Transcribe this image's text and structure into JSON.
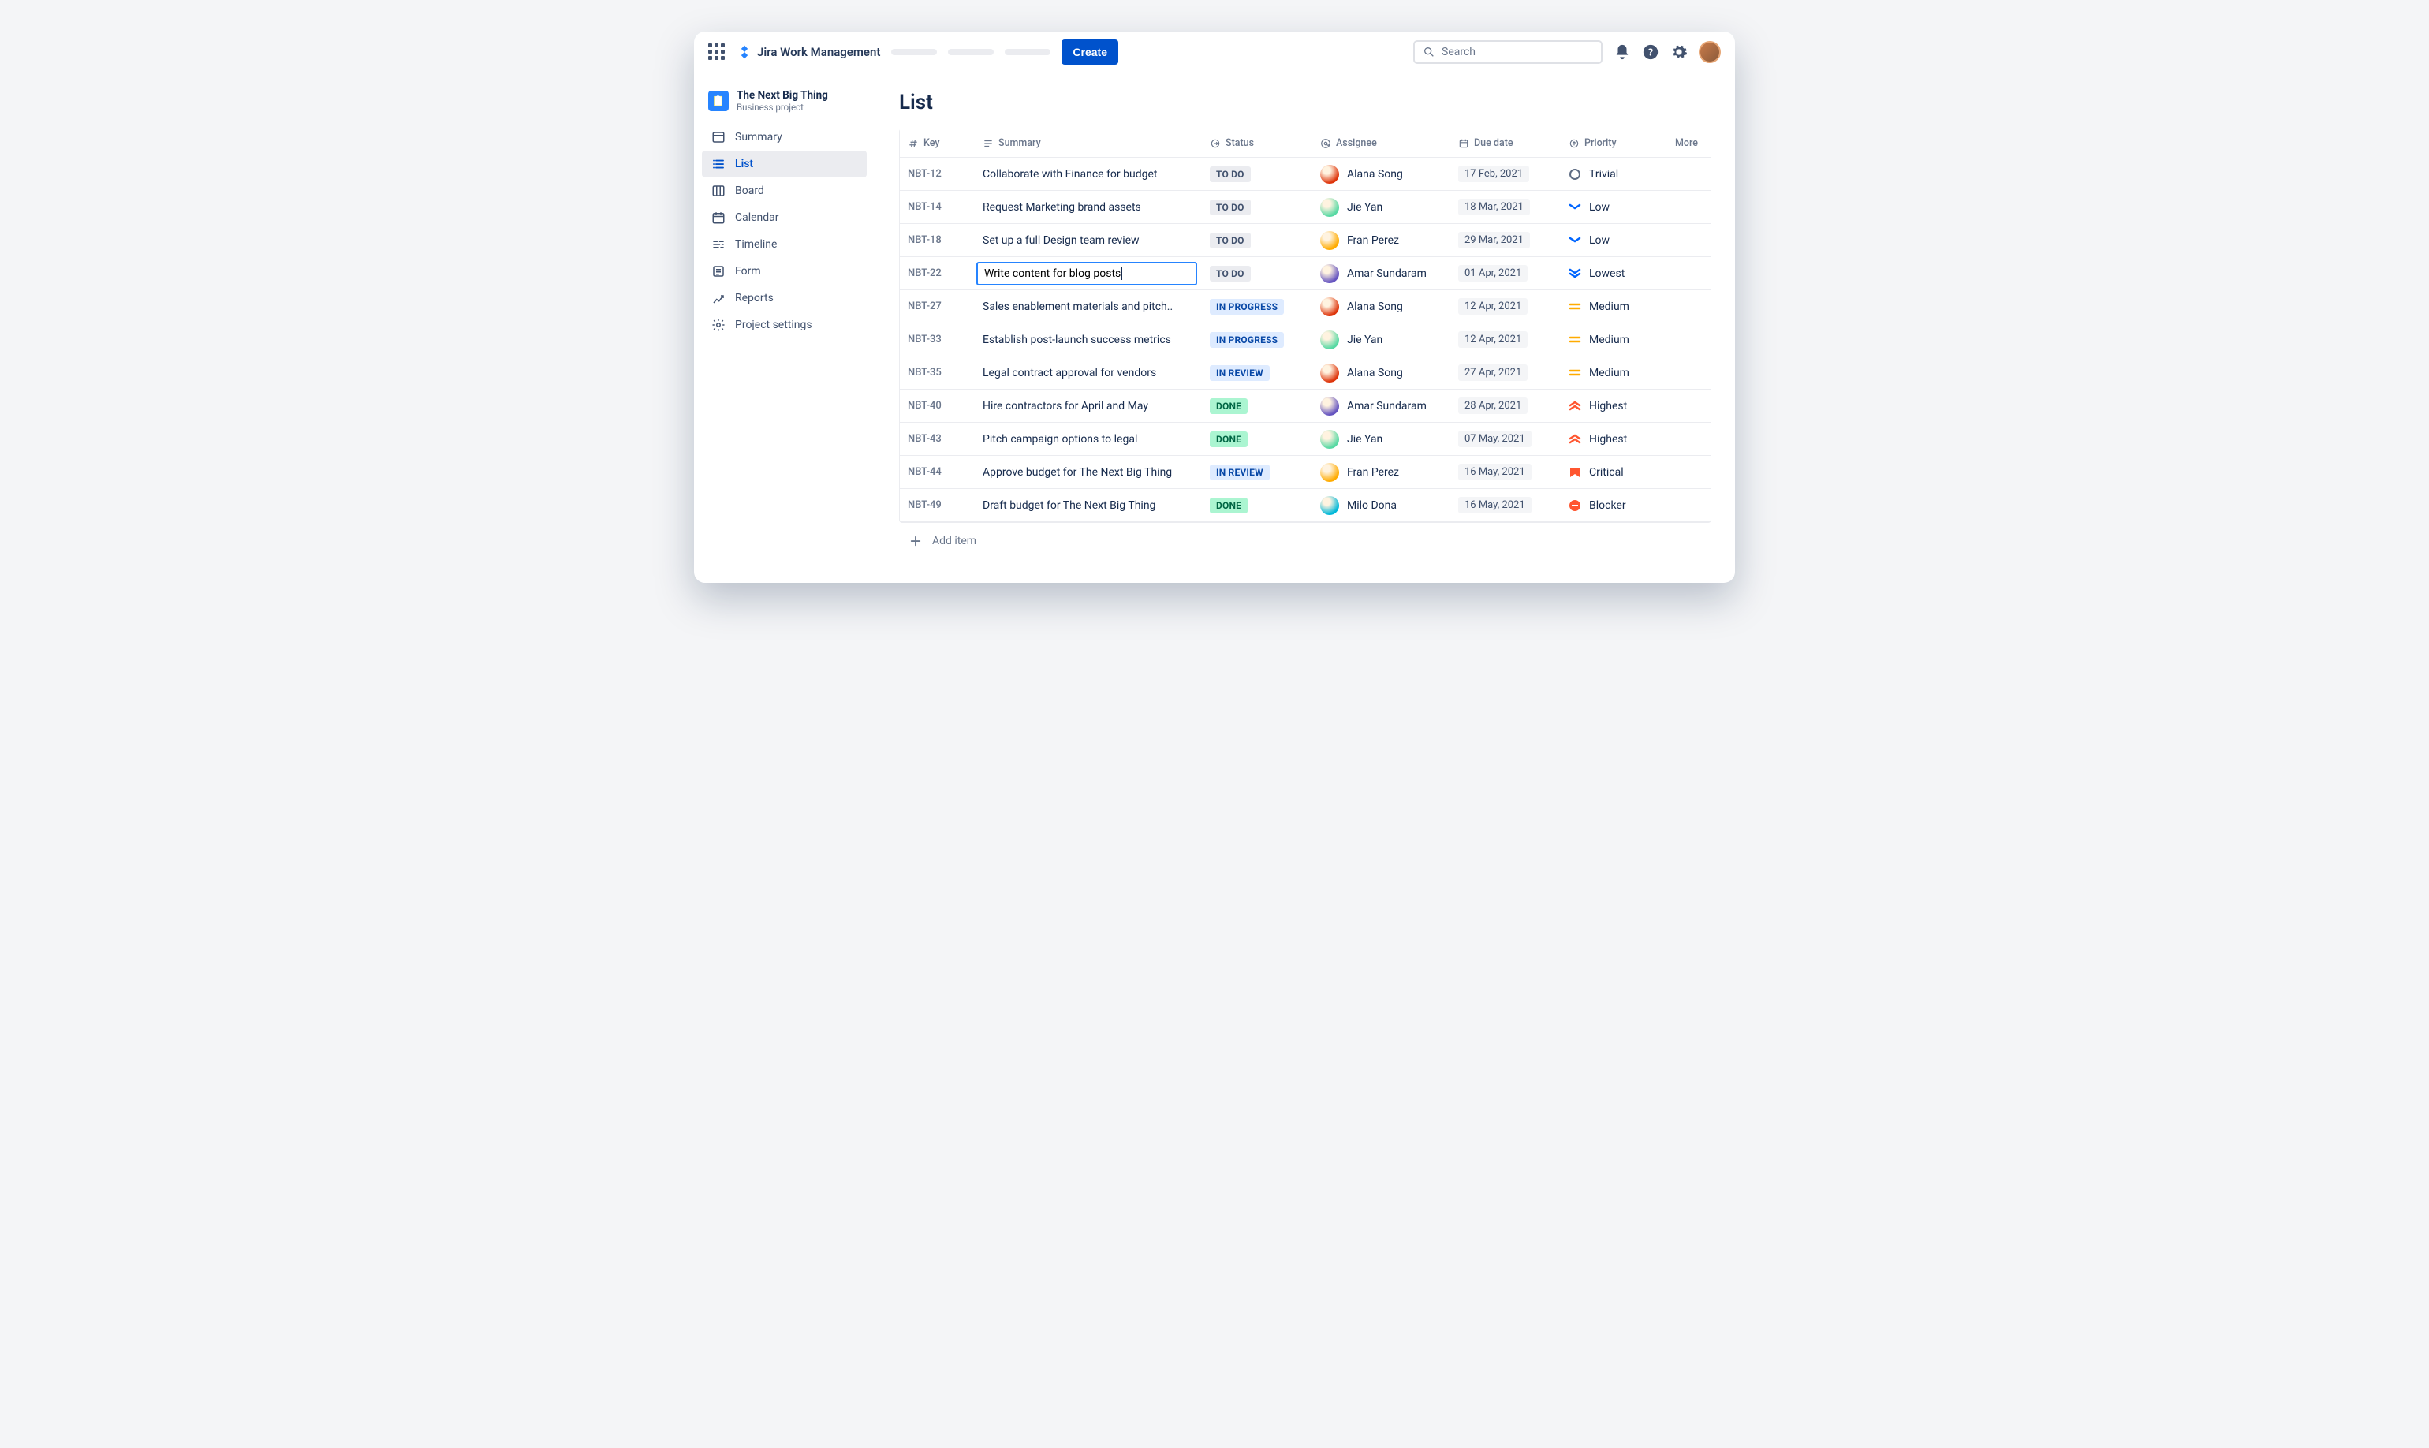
{
  "header": {
    "product_name": "Jira Work Management",
    "create_label": "Create",
    "search_placeholder": "Search"
  },
  "project": {
    "name": "The Next Big Thing",
    "type": "Business project"
  },
  "sidebar": {
    "items": [
      {
        "label": "Summary",
        "icon": "summary"
      },
      {
        "label": "List",
        "icon": "list",
        "active": true
      },
      {
        "label": "Board",
        "icon": "board"
      },
      {
        "label": "Calendar",
        "icon": "calendar"
      },
      {
        "label": "Timeline",
        "icon": "timeline"
      },
      {
        "label": "Form",
        "icon": "form"
      },
      {
        "label": "Reports",
        "icon": "reports"
      },
      {
        "label": "Project settings",
        "icon": "settings"
      }
    ]
  },
  "page": {
    "title": "List",
    "add_item_label": "Add item"
  },
  "columns": {
    "key": "Key",
    "summary": "Summary",
    "status": "Status",
    "assignee": "Assignee",
    "due": "Due date",
    "priority": "Priority",
    "more": "More"
  },
  "rows": [
    {
      "key": "NBT-12",
      "summary": "Collaborate with Finance for budget",
      "status": "TO DO",
      "status_kind": "todo",
      "assignee": "Alana Song",
      "av": "#de350b",
      "due": "17 Feb, 2021",
      "priority": "Trivial",
      "prio_kind": "trivial"
    },
    {
      "key": "NBT-14",
      "summary": "Request Marketing brand assets",
      "status": "TO DO",
      "status_kind": "todo",
      "assignee": "Jie Yan",
      "av": "#57d9a3",
      "due": "18 Mar, 2021",
      "priority": "Low",
      "prio_kind": "low"
    },
    {
      "key": "NBT-18",
      "summary": "Set up a full Design team review",
      "status": "TO DO",
      "status_kind": "todo",
      "assignee": "Fran Perez",
      "av": "#ffab00",
      "due": "29 Mar, 2021",
      "priority": "Low",
      "prio_kind": "low"
    },
    {
      "key": "NBT-22",
      "summary": "Write content for blog posts",
      "status": "TO DO",
      "status_kind": "todo",
      "assignee": "Amar Sundaram",
      "av": "#6554c0",
      "due": "01 Apr, 2021",
      "priority": "Lowest",
      "prio_kind": "lowest",
      "editing": true
    },
    {
      "key": "NBT-27",
      "summary": "Sales enablement materials and pitch..",
      "status": "IN PROGRESS",
      "status_kind": "prog",
      "assignee": "Alana Song",
      "av": "#de350b",
      "due": "12 Apr, 2021",
      "priority": "Medium",
      "prio_kind": "medium"
    },
    {
      "key": "NBT-33",
      "summary": "Establish post-launch success metrics",
      "status": "IN PROGRESS",
      "status_kind": "prog",
      "assignee": "Jie Yan",
      "av": "#57d9a3",
      "due": "12 Apr, 2021",
      "priority": "Medium",
      "prio_kind": "medium"
    },
    {
      "key": "NBT-35",
      "summary": "Legal contract approval for vendors",
      "status": "IN REVIEW",
      "status_kind": "review",
      "assignee": "Alana Song",
      "av": "#de350b",
      "due": "27 Apr, 2021",
      "priority": "Medium",
      "prio_kind": "medium"
    },
    {
      "key": "NBT-40",
      "summary": "Hire contractors for April and May",
      "status": "DONE",
      "status_kind": "done",
      "assignee": "Amar Sundaram",
      "av": "#6554c0",
      "due": "28 Apr, 2021",
      "priority": "Highest",
      "prio_kind": "highest"
    },
    {
      "key": "NBT-43",
      "summary": "Pitch campaign options to legal",
      "status": "DONE",
      "status_kind": "done",
      "assignee": "Jie Yan",
      "av": "#57d9a3",
      "due": "07 May, 2021",
      "priority": "Highest",
      "prio_kind": "highest"
    },
    {
      "key": "NBT-44",
      "summary": "Approve budget for The Next Big Thing",
      "status": "IN REVIEW",
      "status_kind": "review",
      "assignee": "Fran Perez",
      "av": "#ffab00",
      "due": "16 May, 2021",
      "priority": "Critical",
      "prio_kind": "critical"
    },
    {
      "key": "NBT-49",
      "summary": "Draft budget for The Next Big Thing",
      "status": "DONE",
      "status_kind": "done",
      "assignee": "Milo Dona",
      "av": "#00b8d9",
      "due": "16 May, 2021",
      "priority": "Blocker",
      "prio_kind": "blocker"
    }
  ]
}
